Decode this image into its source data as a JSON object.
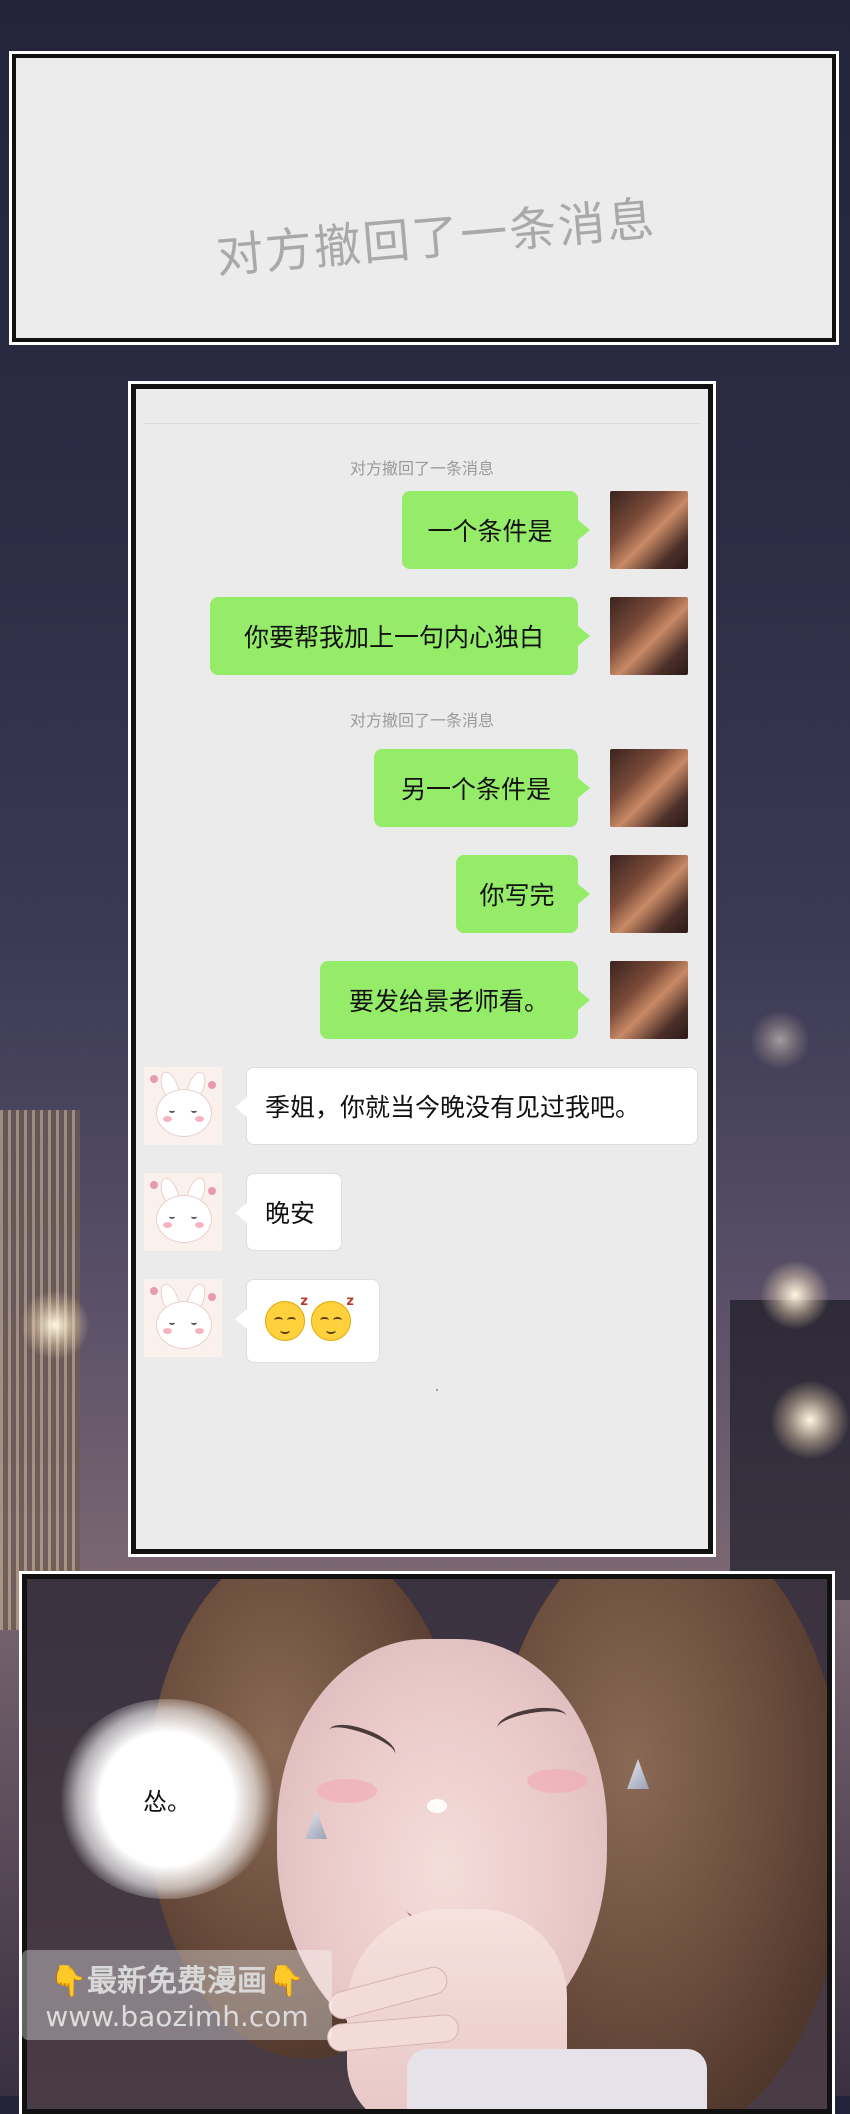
{
  "top_panel": {
    "recall_text": "对方撤回了一条消息"
  },
  "chat": {
    "system_notices": [
      "对方撤回了一条消息",
      "对方撤回了一条消息"
    ],
    "sent_messages": [
      "一个条件是",
      "你要帮我加上一句内心独白",
      "另一个条件是",
      "你写完",
      "要发给景老师看。"
    ],
    "received_messages": [
      "季姐，你就当今晚没有见过我吧。",
      "晚安"
    ],
    "emoji_message": [
      "sleepy-face-emoji",
      "sleepy-face-emoji"
    ],
    "colors": {
      "sent_bubble": "#95ec69",
      "received_bubble": "#ffffff",
      "chat_bg": "#ebebeb"
    }
  },
  "bottom_panel": {
    "speech": "怂。"
  },
  "watermark": {
    "line1": "👇最新免费漫画👇",
    "line2": "www.baozimh.com"
  }
}
